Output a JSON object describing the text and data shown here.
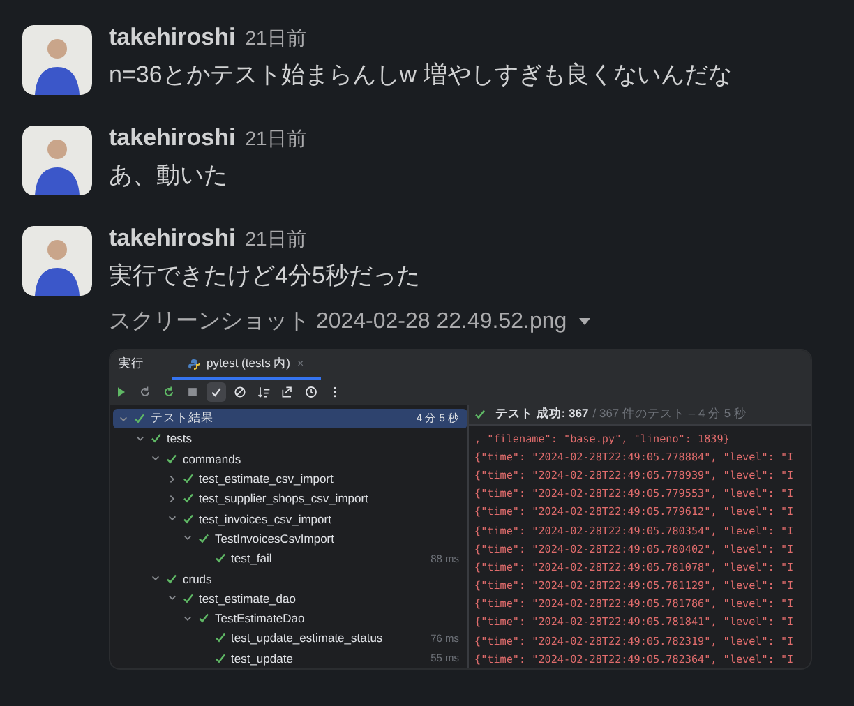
{
  "messages": [
    {
      "user": "takehiroshi",
      "time": "21日前",
      "text": "n=36とかテスト始まらんしw 増やしすぎも良くないんだな"
    },
    {
      "user": "takehiroshi",
      "time": "21日前",
      "text": "あ、動いた"
    },
    {
      "user": "takehiroshi",
      "time": "21日前",
      "text": "実行できたけど4分5秒だった",
      "attachment": {
        "title": "スクリーンショット 2024-02-28 22.49.52.png",
        "screenshot": {
          "tabs": [
            {
              "label": "実行",
              "selected": false
            },
            {
              "label": "pytest (tests 内)",
              "selected": true,
              "close": "×"
            }
          ],
          "toolbar": [
            {
              "kind": "rerun",
              "on": false
            },
            {
              "kind": "rerun-failed",
              "on": false
            },
            {
              "kind": "toggle-rerun",
              "on": false
            },
            {
              "kind": "stop",
              "on": false
            },
            {
              "kind": "show-passed",
              "on": true
            },
            {
              "kind": "show-ignored",
              "on": false
            },
            {
              "kind": "sort",
              "on": false
            },
            {
              "kind": "import",
              "on": false
            },
            {
              "kind": "history",
              "on": false
            },
            {
              "kind": "more",
              "on": false
            }
          ],
          "tree": [
            {
              "label": "テスト結果",
              "time": "4 分 5 秒",
              "expanded": true,
              "selected": true,
              "children": [
                {
                  "label": "tests",
                  "expanded": true,
                  "selected": false,
                  "children": [
                    {
                      "label": "commands",
                      "expanded": true,
                      "selected": false,
                      "children": [
                        {
                          "label": "test_estimate_csv_import",
                          "expanded": false,
                          "selected": false
                        },
                        {
                          "label": "test_supplier_shops_csv_import",
                          "expanded": false,
                          "selected": false
                        },
                        {
                          "label": "test_invoices_csv_import",
                          "expanded": true,
                          "selected": false,
                          "children": [
                            {
                              "label": "TestInvoicesCsvImport",
                              "expanded": true,
                              "selected": false,
                              "children": [
                                {
                                  "label": "test_fail",
                                  "time": "88 ms",
                                  "selected": false
                                }
                              ]
                            }
                          ]
                        }
                      ]
                    },
                    {
                      "label": "cruds",
                      "expanded": true,
                      "selected": false,
                      "children": [
                        {
                          "label": "test_estimate_dao",
                          "expanded": true,
                          "selected": false,
                          "children": [
                            {
                              "label": "TestEstimateDao",
                              "expanded": true,
                              "selected": false,
                              "children": [
                                {
                                  "label": "test_update_estimate_status",
                                  "time": "76 ms",
                                  "selected": false
                                },
                                {
                                  "label": "test_update",
                                  "time": "55 ms",
                                  "selected": false
                                }
                              ]
                            }
                          ]
                        }
                      ]
                    }
                  ]
                }
              ]
            }
          ],
          "status": "テスト 成功: 367",
          "summary": "/ 367 件のテスト – 4 分 5 秒",
          "log": [
            ", \"filename\": \"base.py\", \"lineno\": 1839}",
            "{\"time\": \"2024-02-28T22:49:05.778884\", \"level\": \"I",
            "{\"time\": \"2024-02-28T22:49:05.778939\", \"level\": \"I",
            "{\"time\": \"2024-02-28T22:49:05.779553\", \"level\": \"I",
            "{\"time\": \"2024-02-28T22:49:05.779612\", \"level\": \"I",
            "{\"time\": \"2024-02-28T22:49:05.780354\", \"level\": \"I",
            "{\"time\": \"2024-02-28T22:49:05.780402\", \"level\": \"I",
            "{\"time\": \"2024-02-28T22:49:05.781078\", \"level\": \"I",
            "{\"time\": \"2024-02-28T22:49:05.781129\", \"level\": \"I",
            "{\"time\": \"2024-02-28T22:49:05.781786\", \"level\": \"I",
            "{\"time\": \"2024-02-28T22:49:05.781841\", \"level\": \"I",
            "{\"time\": \"2024-02-28T22:49:05.782319\", \"level\": \"I",
            "{\"time\": \"2024-02-28T22:49:05.782364\", \"level\": \"I"
          ]
        }
      }
    }
  ]
}
